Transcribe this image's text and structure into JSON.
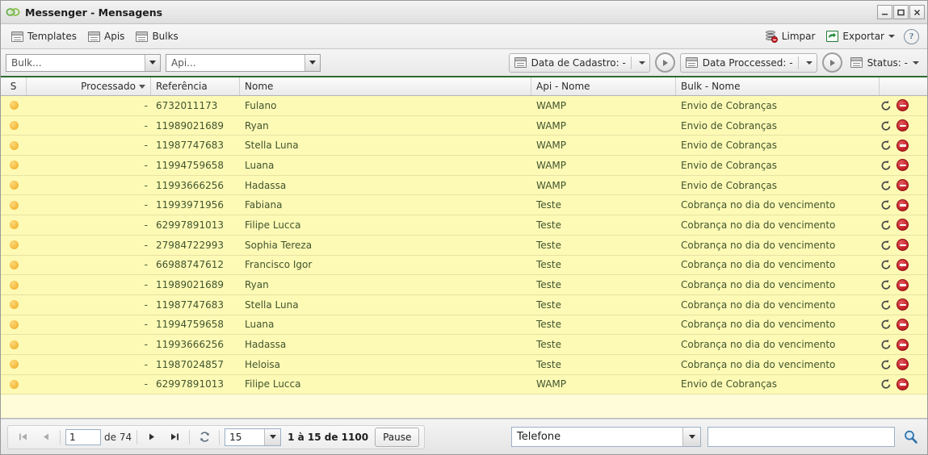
{
  "window": {
    "title": "Messenger - Mensagens",
    "app_icon": "chain-link-icon",
    "minimize_label": "–",
    "maximize_label": "☐",
    "close_label": "✕"
  },
  "toolbar": {
    "left_buttons": [
      {
        "label": "Templates",
        "icon": "grid-icon"
      },
      {
        "label": "Apis",
        "icon": "grid-icon"
      },
      {
        "label": "Bulks",
        "icon": "grid-icon"
      }
    ],
    "right_buttons": [
      {
        "label": "Limpar",
        "icon": "database-delete-icon"
      },
      {
        "label": "Exportar",
        "icon": "export-arrow-icon",
        "has_caret": true
      },
      {
        "label": "?",
        "icon": "help-icon"
      }
    ]
  },
  "filterbar": {
    "bulk_select": {
      "value": "Bulk...",
      "icon": "chevron-down-icon"
    },
    "api_select": {
      "value": "Api...",
      "icon": "chevron-down-icon"
    },
    "date_cadastro": {
      "label": "Data de Cadastro: -",
      "icon": "grid-icon"
    },
    "date_cadastro_go": "play-circle-icon",
    "date_processed": {
      "label": "Data Proccessed: -",
      "icon": "grid-icon"
    },
    "date_processed_go": "play-circle-icon",
    "status": {
      "label": "Status: -",
      "icon": "grid-icon"
    }
  },
  "grid": {
    "columns": [
      {
        "key": "s",
        "label": "S"
      },
      {
        "key": "proc",
        "label": "Processado",
        "sorted": true
      },
      {
        "key": "ref",
        "label": "Referência"
      },
      {
        "key": "nome",
        "label": "Nome"
      },
      {
        "key": "api",
        "label": "Api - Nome"
      },
      {
        "key": "bulk",
        "label": "Bulk - Nome"
      },
      {
        "key": "act",
        "label": ""
      }
    ],
    "row_actions": [
      {
        "name": "retry-icon",
        "title": "Reenviar"
      },
      {
        "name": "block-icon",
        "title": "Cancelar"
      }
    ],
    "status_color": "#f6bf45",
    "row_background": "#fdfab5",
    "rows": [
      {
        "s": "",
        "proc": "-",
        "ref": "6732011173",
        "nome": "Fulano",
        "api": "WAMP",
        "bulk": "Envio de Cobranças"
      },
      {
        "s": "",
        "proc": "-",
        "ref": "11989021689",
        "nome": "Ryan",
        "api": "WAMP",
        "bulk": "Envio de Cobranças"
      },
      {
        "s": "",
        "proc": "-",
        "ref": "11987747683",
        "nome": "Stella Luna",
        "api": "WAMP",
        "bulk": "Envio de Cobranças"
      },
      {
        "s": "",
        "proc": "-",
        "ref": "11994759658",
        "nome": "Luana",
        "api": "WAMP",
        "bulk": "Envio de Cobranças"
      },
      {
        "s": "",
        "proc": "-",
        "ref": "11993666256",
        "nome": "Hadassa",
        "api": "WAMP",
        "bulk": "Envio de Cobranças"
      },
      {
        "s": "",
        "proc": "-",
        "ref": "11993971956",
        "nome": "Fabiana",
        "api": "Teste",
        "bulk": "Cobrança no dia do vencimento"
      },
      {
        "s": "",
        "proc": "-",
        "ref": "62997891013",
        "nome": "Filipe Lucca",
        "api": "Teste",
        "bulk": "Cobrança no dia do vencimento"
      },
      {
        "s": "",
        "proc": "-",
        "ref": "27984722993",
        "nome": "Sophia Tereza",
        "api": "Teste",
        "bulk": "Cobrança no dia do vencimento"
      },
      {
        "s": "",
        "proc": "-",
        "ref": "66988747612",
        "nome": "Francisco Igor",
        "api": "Teste",
        "bulk": "Cobrança no dia do vencimento"
      },
      {
        "s": "",
        "proc": "-",
        "ref": "11989021689",
        "nome": "Ryan",
        "api": "Teste",
        "bulk": "Cobrança no dia do vencimento"
      },
      {
        "s": "",
        "proc": "-",
        "ref": "11987747683",
        "nome": "Stella Luna",
        "api": "Teste",
        "bulk": "Cobrança no dia do vencimento"
      },
      {
        "s": "",
        "proc": "-",
        "ref": "11994759658",
        "nome": "Luana",
        "api": "Teste",
        "bulk": "Cobrança no dia do vencimento"
      },
      {
        "s": "",
        "proc": "-",
        "ref": "11993666256",
        "nome": "Hadassa",
        "api": "Teste",
        "bulk": "Cobrança no dia do vencimento"
      },
      {
        "s": "",
        "proc": "-",
        "ref": "11987024857",
        "nome": "Heloisa",
        "api": "Teste",
        "bulk": "Cobrança no dia do vencimento"
      },
      {
        "s": "",
        "proc": "-",
        "ref": "62997891013",
        "nome": "Filipe Lucca",
        "api": "WAMP",
        "bulk": "Envio de Cobranças"
      }
    ]
  },
  "pager": {
    "first_icon": "first-page-icon",
    "prev_icon": "prev-page-icon",
    "page_value": "1",
    "of_label": "de 74",
    "next_icon": "next-page-icon",
    "last_icon": "last-page-icon",
    "refresh_icon": "refresh-icon",
    "page_size": "15",
    "summary": "1 à 15 de 1100",
    "pause_label": "Pause"
  },
  "search": {
    "field_select": "Telefone",
    "input_value": "",
    "input_placeholder": "",
    "go_icon": "magnifier-icon"
  }
}
